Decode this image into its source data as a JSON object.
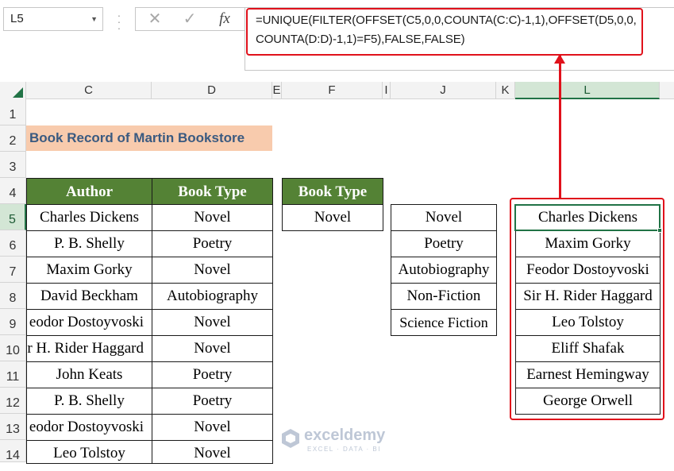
{
  "name_box": "L5",
  "formula_bar": {
    "cancel_icon": "✕",
    "enter_icon": "✓",
    "fx_label": "fx",
    "formula": "=UNIQUE(FILTER(OFFSET(C5,0,0,COUNTA(C:C)-1,1),OFFSET(D5,0,0,COUNTA(D:D)-1,1)=F5),FALSE,FALSE)"
  },
  "columns": [
    "C",
    "D",
    "E",
    "F",
    "I",
    "J",
    "K",
    "L"
  ],
  "selected_column": "L",
  "rows": [
    "1",
    "2",
    "3",
    "4",
    "5",
    "6",
    "7",
    "8",
    "9",
    "10",
    "11",
    "12",
    "13",
    "14"
  ],
  "selected_row": "5",
  "title": "Book Record of Martin Bookstore",
  "table": {
    "headers": [
      "Author",
      "Book Type"
    ],
    "rows": [
      [
        "Charles Dickens",
        "Novel"
      ],
      [
        "P. B. Shelly",
        "Poetry"
      ],
      [
        "Maxim Gorky",
        "Novel"
      ],
      [
        "David Beckham",
        "Autobiography"
      ],
      [
        "eodor Dostoyvoski",
        "Novel"
      ],
      [
        "r H. Rider Haggard",
        "Novel"
      ],
      [
        "John Keats",
        "Poetry"
      ],
      [
        "P. B. Shelly",
        "Poetry"
      ],
      [
        "eodor Dostoyvoski",
        "Novel"
      ],
      [
        "Leo Tolstoy",
        "Novel"
      ]
    ]
  },
  "criteria": {
    "header": "Book Type",
    "value": "Novel"
  },
  "types_list": [
    "Novel",
    "Poetry",
    "Autobiography",
    "Non-Fiction",
    "Science Fiction"
  ],
  "result_list": [
    "Charles Dickens",
    "Maxim Gorky",
    "Feodor Dostoyvoski",
    "Sir H. Rider Haggard",
    "Leo Tolstoy",
    "Eliff Shafak",
    "Earnest Hemingway",
    "George Orwell"
  ],
  "watermark": {
    "name": "exceldemy",
    "tagline": "EXCEL · DATA · BI"
  },
  "colors": {
    "header_green": "#548235",
    "title_fill": "#f8cbad",
    "annotation_red": "#e0111b",
    "selection_green": "#217346"
  }
}
